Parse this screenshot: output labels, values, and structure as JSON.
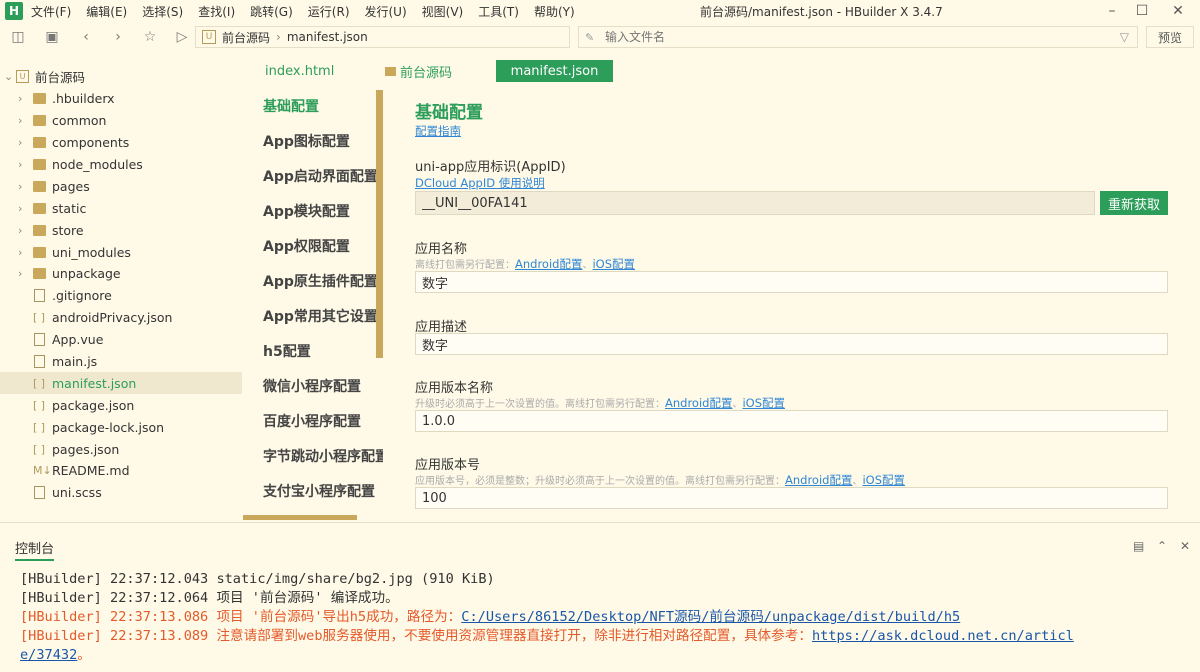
{
  "window": {
    "title": "前台源码/manifest.json - HBuilder X 3.4.7",
    "menu": [
      "文件(F)",
      "编辑(E)",
      "选择(S)",
      "查找(I)",
      "跳转(G)",
      "运行(R)",
      "发行(U)",
      "视图(V)",
      "工具(T)",
      "帮助(Y)"
    ]
  },
  "toolbar": {
    "breadcrumb": [
      "前台源码",
      "manifest.json"
    ],
    "file_search_placeholder": "输入文件名",
    "preview_label": "预览"
  },
  "sidebar": {
    "root": "前台源码",
    "items": [
      {
        "label": ".hbuilderx",
        "type": "folder"
      },
      {
        "label": "common",
        "type": "folder"
      },
      {
        "label": "components",
        "type": "folder"
      },
      {
        "label": "node_modules",
        "type": "folder"
      },
      {
        "label": "pages",
        "type": "folder"
      },
      {
        "label": "static",
        "type": "folder"
      },
      {
        "label": "store",
        "type": "folder"
      },
      {
        "label": "uni_modules",
        "type": "folder"
      },
      {
        "label": "unpackage",
        "type": "folder"
      },
      {
        "label": ".gitignore",
        "type": "file"
      },
      {
        "label": "androidPrivacy.json",
        "type": "json"
      },
      {
        "label": "App.vue",
        "type": "file"
      },
      {
        "label": "main.js",
        "type": "file"
      },
      {
        "label": "manifest.json",
        "type": "json",
        "selected": true
      },
      {
        "label": "package.json",
        "type": "json"
      },
      {
        "label": "package-lock.json",
        "type": "json"
      },
      {
        "label": "pages.json",
        "type": "json"
      },
      {
        "label": "README.md",
        "type": "md"
      },
      {
        "label": "uni.scss",
        "type": "file"
      }
    ]
  },
  "editor_tabs": {
    "tab1": "index.html",
    "tab2": "前台源码",
    "active": "manifest.json"
  },
  "config_nav": [
    "基础配置",
    "App图标配置",
    "App启动界面配置",
    "App模块配置",
    "App权限配置",
    "App原生插件配置",
    "App常用其它设置",
    "h5配置",
    "微信小程序配置",
    "百度小程序配置",
    "字节跳动小程序配置",
    "支付宝小程序配置"
  ],
  "form": {
    "title": "基础配置",
    "guide_link": "配置指南",
    "appid": {
      "label": "uni-app应用标识(AppID)",
      "help_link": "DCloud AppID 使用说明",
      "value": "__UNI__00FA141",
      "refresh_label": "重新获取"
    },
    "app_name": {
      "label": "应用名称",
      "hint": "离线打包需另行配置：",
      "android_link": "Android配置",
      "sep": "、",
      "ios_link": "iOS配置",
      "value": "数字"
    },
    "app_desc": {
      "label": "应用描述",
      "value": "数字"
    },
    "version_name": {
      "label": "应用版本名称",
      "hint": "升级时必须高于上一次设置的值。离线打包需另行配置：",
      "android_link": "Android配置",
      "sep": "、",
      "ios_link": "iOS配置",
      "value": "1.0.0"
    },
    "version_code": {
      "label": "应用版本号",
      "hint": "应用版本号，必须是整数；升级时必须高于上一次设置的值。离线打包需另行配置：",
      "android_link": "Android配置",
      "sep": "、",
      "ios_link": "iOS配置",
      "value": "100"
    }
  },
  "console": {
    "tab": "控制台",
    "lines": [
      {
        "tag": "[HBuilder]",
        "time": "22:37:12.043",
        "msg": "  static/img/share/bg2.jpg (910 KiB)",
        "url": "",
        "url2": "",
        "error": false
      },
      {
        "tag": "[HBuilder]",
        "time": "22:37:12.064",
        "msg": "项目 '前台源码' 编译成功。",
        "url": "",
        "url2": "",
        "error": false
      },
      {
        "tag": "[HBuilder]",
        "time": "22:37:13.086",
        "msg": "项目 '前台源码'导出h5成功，路径为：",
        "url": "C:/Users/86152/Desktop/NFT源码/前台源码/unpackage/dist/build/h5",
        "url2": "",
        "error": true
      },
      {
        "tag": "[HBuilder]",
        "time": "22:37:13.089",
        "msg": "注意请部署到web服务器使用，不要使用资源管理器直接打开，除非进行相对路径配置，具体参考：",
        "url": "https://ask.dcloud.net.cn/articl",
        "url2": "e/37432",
        "tail": "。",
        "error": true
      }
    ]
  }
}
